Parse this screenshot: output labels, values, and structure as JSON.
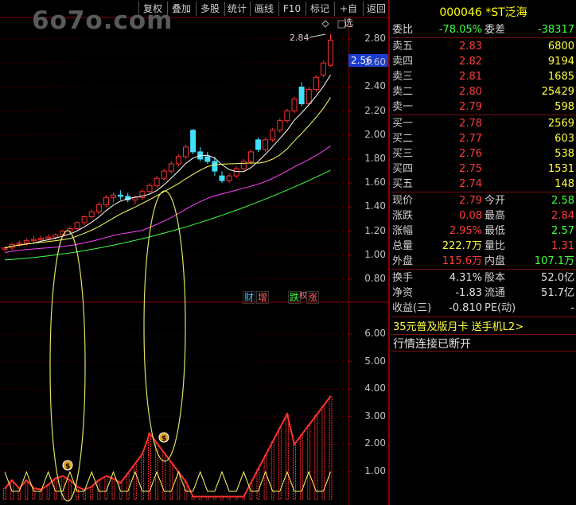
{
  "toolbar": {
    "buttons": [
      "复权",
      "叠加",
      "多股",
      "统计",
      "画线",
      "F10",
      "标记",
      "+自选",
      "返回"
    ]
  },
  "watermark": "6o7o.com",
  "chart": {
    "price_axis": [
      "2.80",
      "2.60",
      "2.40",
      "2.20",
      "2.00",
      "1.80",
      "1.60",
      "1.40",
      "1.20",
      "1.00",
      "0.80"
    ],
    "indicator_axis": [
      "6.00",
      "5.00",
      "4.00",
      "3.00",
      "2.00",
      "1.00"
    ],
    "high_label": "2.84",
    "current_price_box": "2.56",
    "tags": [
      {
        "text": "财",
        "color": "#40c0ff"
      },
      {
        "text": "增",
        "color": "#ff6060"
      },
      {
        "text": "跌",
        "color": "#40ff40"
      },
      {
        "text": "涨",
        "color": "#ff6060"
      }
    ],
    "tag_prefix": "权",
    "money_icon": "money-bag-icon",
    "colors": {
      "up": "#ff3030",
      "down": "#40e0ff",
      "ma5": "#ffffff",
      "ma10": "#ffff60",
      "ma20": "#ff40ff",
      "ma60": "#40ff40",
      "grid": "#8b0000",
      "ellipse": "#e0e060"
    }
  },
  "panel": {
    "title": "000046 *ST泛海",
    "weibi": {
      "label": "委比",
      "value": "-78.05%",
      "label2": "委差",
      "value2": "-38317"
    },
    "sells": [
      {
        "label": "卖五",
        "price": "2.83",
        "vol": "6800"
      },
      {
        "label": "卖四",
        "price": "2.82",
        "vol": "9194"
      },
      {
        "label": "卖三",
        "price": "2.81",
        "vol": "1685"
      },
      {
        "label": "卖二",
        "price": "2.80",
        "vol": "25429"
      },
      {
        "label": "卖一",
        "price": "2.79",
        "vol": "598"
      }
    ],
    "buys": [
      {
        "label": "买一",
        "price": "2.78",
        "vol": "2569"
      },
      {
        "label": "买二",
        "price": "2.77",
        "vol": "603"
      },
      {
        "label": "买三",
        "price": "2.76",
        "vol": "538"
      },
      {
        "label": "买四",
        "price": "2.75",
        "vol": "1531"
      },
      {
        "label": "买五",
        "price": "2.74",
        "vol": "148"
      }
    ],
    "stats": [
      {
        "l1": "现价",
        "v1": "2.79",
        "c1": "red",
        "l2": "今开",
        "v2": "2.58",
        "c2": "green"
      },
      {
        "l1": "涨跌",
        "v1": "0.08",
        "c1": "red",
        "l2": "最高",
        "v2": "2.84",
        "c2": "red"
      },
      {
        "l1": "涨幅",
        "v1": "2.95%",
        "c1": "red",
        "l2": "最低",
        "v2": "2.57",
        "c2": "green"
      },
      {
        "l1": "总量",
        "v1": "222.7万",
        "c1": "yellow",
        "l2": "量比",
        "v2": "1.31",
        "c2": "red"
      },
      {
        "l1": "外盘",
        "v1": "115.6万",
        "c1": "red",
        "l2": "内盘",
        "v2": "107.1万",
        "c2": "green"
      }
    ],
    "stats2": [
      {
        "l1": "换手",
        "v1": "4.31%",
        "l2": "股本",
        "v2": "52.0亿"
      },
      {
        "l1": "净资",
        "v1": "-1.83",
        "l2": "流通",
        "v2": "51.7亿"
      },
      {
        "l1": "收益(三)",
        "v1": "-0.810",
        "l2": "PE(动)",
        "v2": "-"
      }
    ],
    "promo": "35元普及版月卡 送手机L2>",
    "status": "行情连接已断开"
  }
}
